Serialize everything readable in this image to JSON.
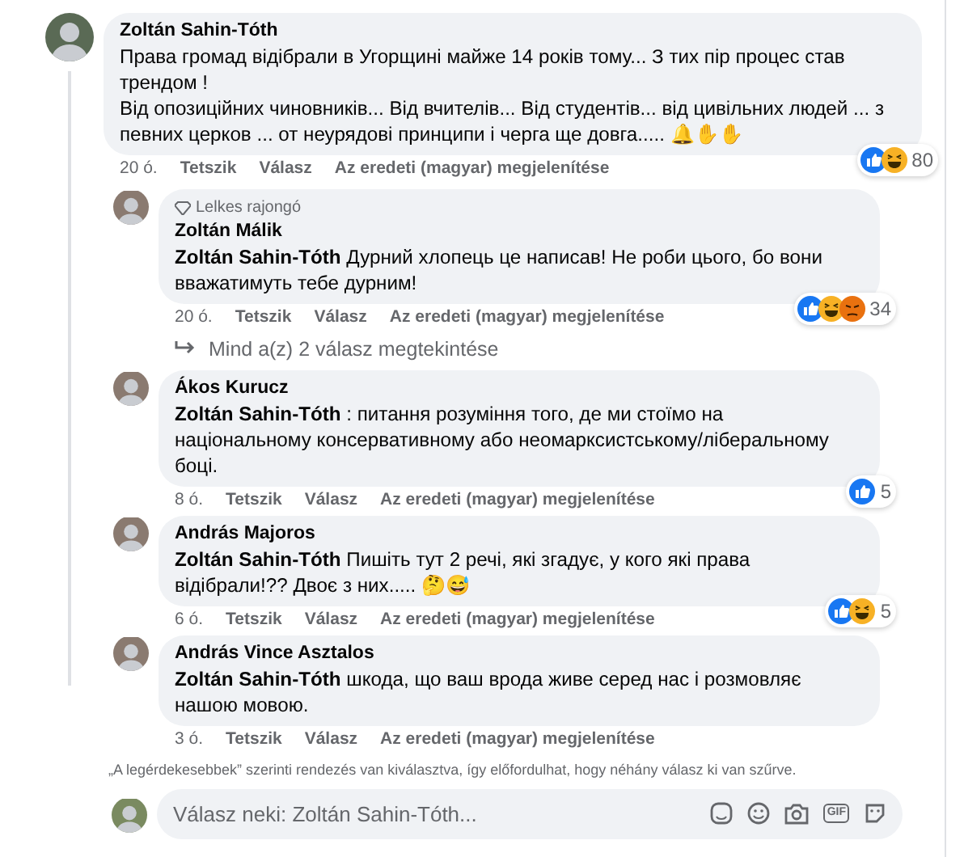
{
  "comments": [
    {
      "author": "Zoltán Sahin-Tóth",
      "text": "Права громад відібрали в Угорщині майже 14 років тому... З тих пір процес став трендом !\nВід опозиційних чиновників... Від вчителів... Від студентів... від цивільних людей ... з певних церков ... от неурядові принципи і черга ще довга..... 🔔✋✋",
      "time": "20 ó.",
      "actions": [
        "Tetszik",
        "Válasz",
        "Az eredeti (magyar) megjelenítése"
      ],
      "reactions": {
        "like": true,
        "haha": true,
        "count": "80"
      },
      "replies": [
        {
          "badge": "Lelkes rajongó",
          "author": "Zoltán Málik",
          "mention": "Zoltán Sahin-Tóth",
          "text": "Дурний хлопець це написав! Не роби цього, бо вони вважатимуть тебе дурним!",
          "time": "20 ó.",
          "actions": [
            "Tetszik",
            "Válasz",
            "Az eredeti (magyar) megjelenítése"
          ],
          "reactions": {
            "like": true,
            "haha": true,
            "angry": true,
            "count": "34"
          },
          "more": "Mind a(z) 2 válasz megtekintése"
        },
        {
          "author": "Ákos Kurucz",
          "mention": "Zoltán Sahin-Tóth",
          "text": " : питання розуміння того, де ми стоїмо на національному консервативному або неомарксистському/ліберальному боці.",
          "time": "8 ó.",
          "actions": [
            "Tetszik",
            "Válasz",
            "Az eredeti (magyar) megjelenítése"
          ],
          "reactions": {
            "like": true,
            "count": "5"
          }
        },
        {
          "author": "András Majoros",
          "mention": "Zoltán Sahin-Tóth",
          "text": "Пишіть тут 2 речі, які згадує, у кого які права відібрали!?? Двоє з них..... 🤔😅",
          "time": "6 ó.",
          "actions": [
            "Tetszik",
            "Válasz",
            "Az eredeti (magyar) megjelenítése"
          ],
          "reactions": {
            "like": true,
            "haha": true,
            "count": "5"
          }
        },
        {
          "author": "András Vince Asztalos",
          "mention": "Zoltán Sahin-Tóth",
          "text": "шкода, що ваш врода живе серед нас і розмовляє нашою мовою.",
          "time": "3 ó.",
          "actions": [
            "Tetszik",
            "Válasz",
            "Az eredeti (magyar) megjelenítése"
          ]
        }
      ]
    }
  ],
  "sort_note": "„A legérdekesebbek” szerinti rendezés van kiválasztva, így előfordulhat, hogy néhány válasz ki van szűrve.",
  "reply_field": {
    "placeholder": "Válasz neki: Zoltán Sahin-Tóth...",
    "gif_label": "GIF"
  }
}
